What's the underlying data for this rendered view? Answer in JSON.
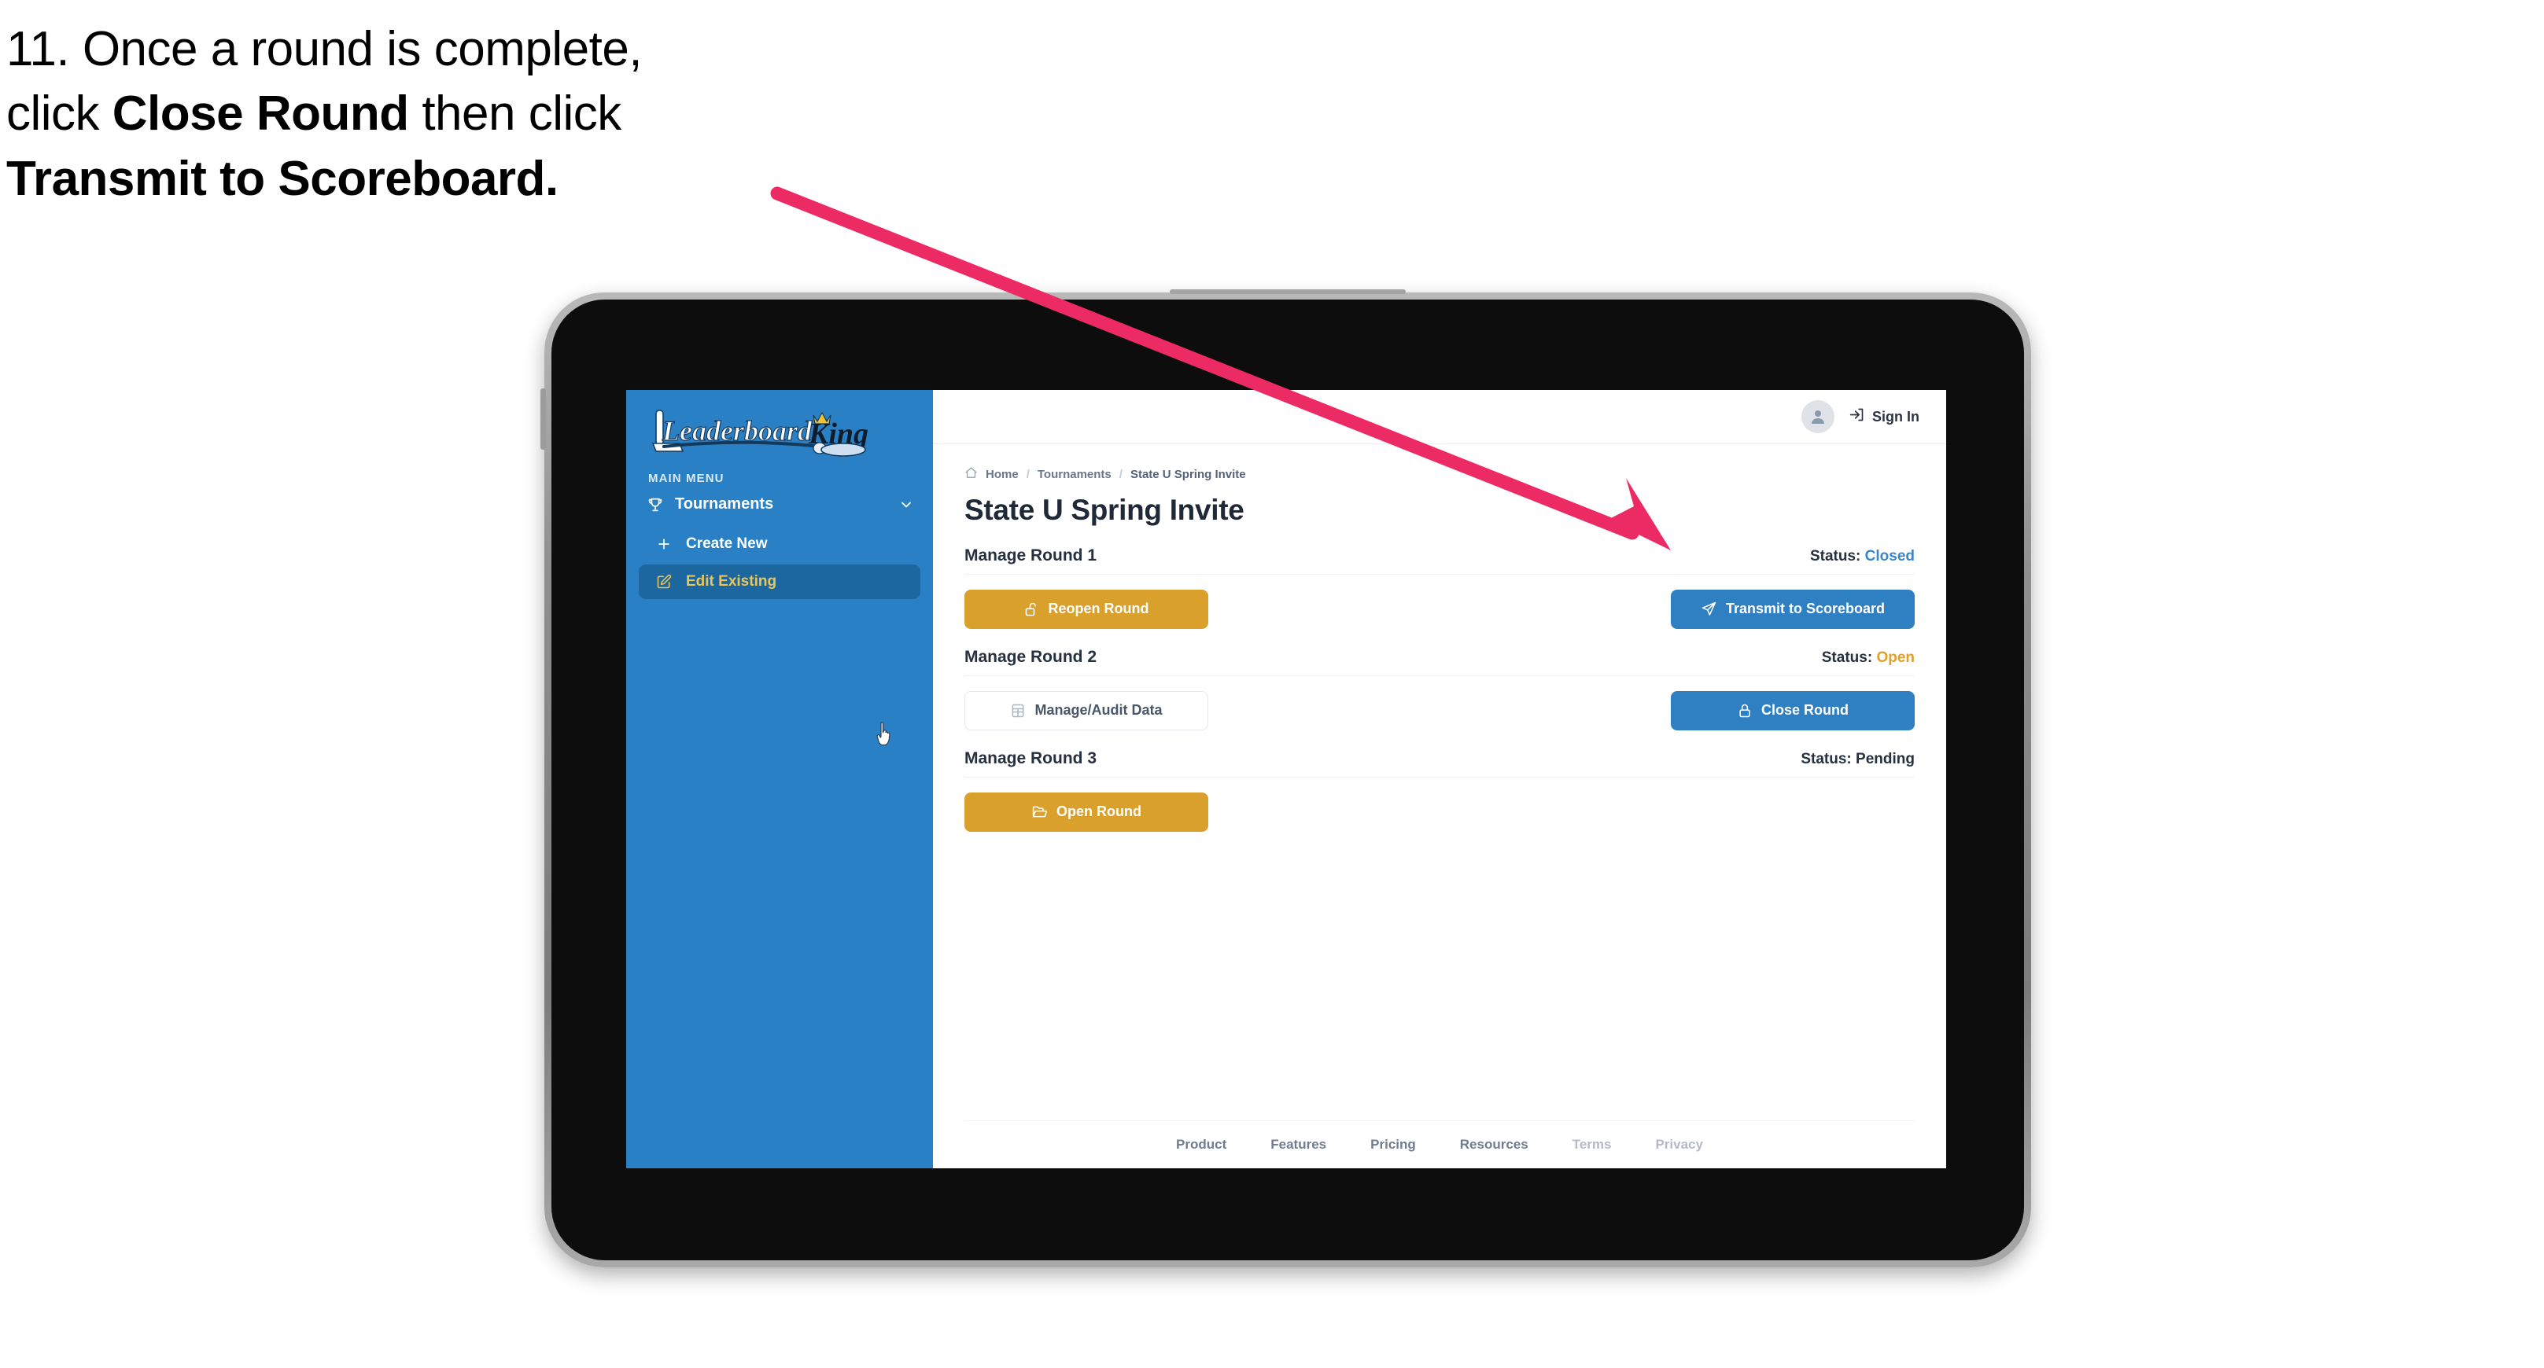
{
  "caption": {
    "number": "11.",
    "part1": "Once a round is complete,",
    "part2_pre": "click ",
    "part2_bold": "Close Round",
    "part2_post": " then click",
    "part3_bold": "Transmit to Scoreboard."
  },
  "app": {
    "logo_text_left": "Leaderboard",
    "logo_text_right": "King"
  },
  "sidebar": {
    "section_label": "MAIN MENU",
    "items": [
      {
        "label": "Tournaments",
        "icon": "trophy-icon",
        "expanded": true
      },
      {
        "label": "Create New",
        "icon": "plus-icon",
        "active": false
      },
      {
        "label": "Edit Existing",
        "icon": "edit-pencil-icon",
        "active": true
      }
    ]
  },
  "topbar": {
    "signin_label": "Sign In",
    "avatar_icon": "user-avatar-icon",
    "signin_icon": "sign-in-arrow-icon"
  },
  "breadcrumb": {
    "home_icon": "home-icon",
    "items": [
      "Home",
      "Tournaments",
      "State U Spring Invite"
    ],
    "separator": "/"
  },
  "page": {
    "title": "State U Spring Invite"
  },
  "rounds": [
    {
      "title": "Manage Round 1",
      "status_label": "Status:",
      "status_value": "Closed",
      "status_kind": "closed",
      "left_button": {
        "label": "Reopen Round",
        "icon": "unlock-icon",
        "style": "gold"
      },
      "right_button": {
        "label": "Transmit to Scoreboard",
        "icon": "paper-plane-icon",
        "style": "blue"
      }
    },
    {
      "title": "Manage Round 2",
      "status_label": "Status:",
      "status_value": "Open",
      "status_kind": "open",
      "left_button": {
        "label": "Manage/Audit Data",
        "icon": "table-grid-icon",
        "style": "ghost"
      },
      "right_button": {
        "label": "Close Round",
        "icon": "lock-closed-icon",
        "style": "blue"
      }
    },
    {
      "title": "Manage Round 3",
      "status_label": "Status:",
      "status_value": "Pending",
      "status_kind": "pending",
      "left_button": {
        "label": "Open Round",
        "icon": "open-folder-icon",
        "style": "gold"
      },
      "right_button": null
    }
  ],
  "footer": {
    "links": [
      {
        "label": "Product",
        "muted": false
      },
      {
        "label": "Features",
        "muted": false
      },
      {
        "label": "Pricing",
        "muted": false
      },
      {
        "label": "Resources",
        "muted": false
      },
      {
        "label": "Terms",
        "muted": true
      },
      {
        "label": "Privacy",
        "muted": true
      }
    ]
  },
  "colors": {
    "sidebar_blue": "#2980c4",
    "sidebar_active": "#1c679f",
    "accent_gold": "#d9a02c",
    "accent_blue": "#2f80c2",
    "status_closed": "#3a86c8",
    "status_open": "#dfa12c",
    "arrow_pink": "#ec2a63"
  },
  "annotation": {
    "arrow_icon": "pink-pointer-arrow",
    "cursor_icon": "pointing-hand-cursor"
  }
}
